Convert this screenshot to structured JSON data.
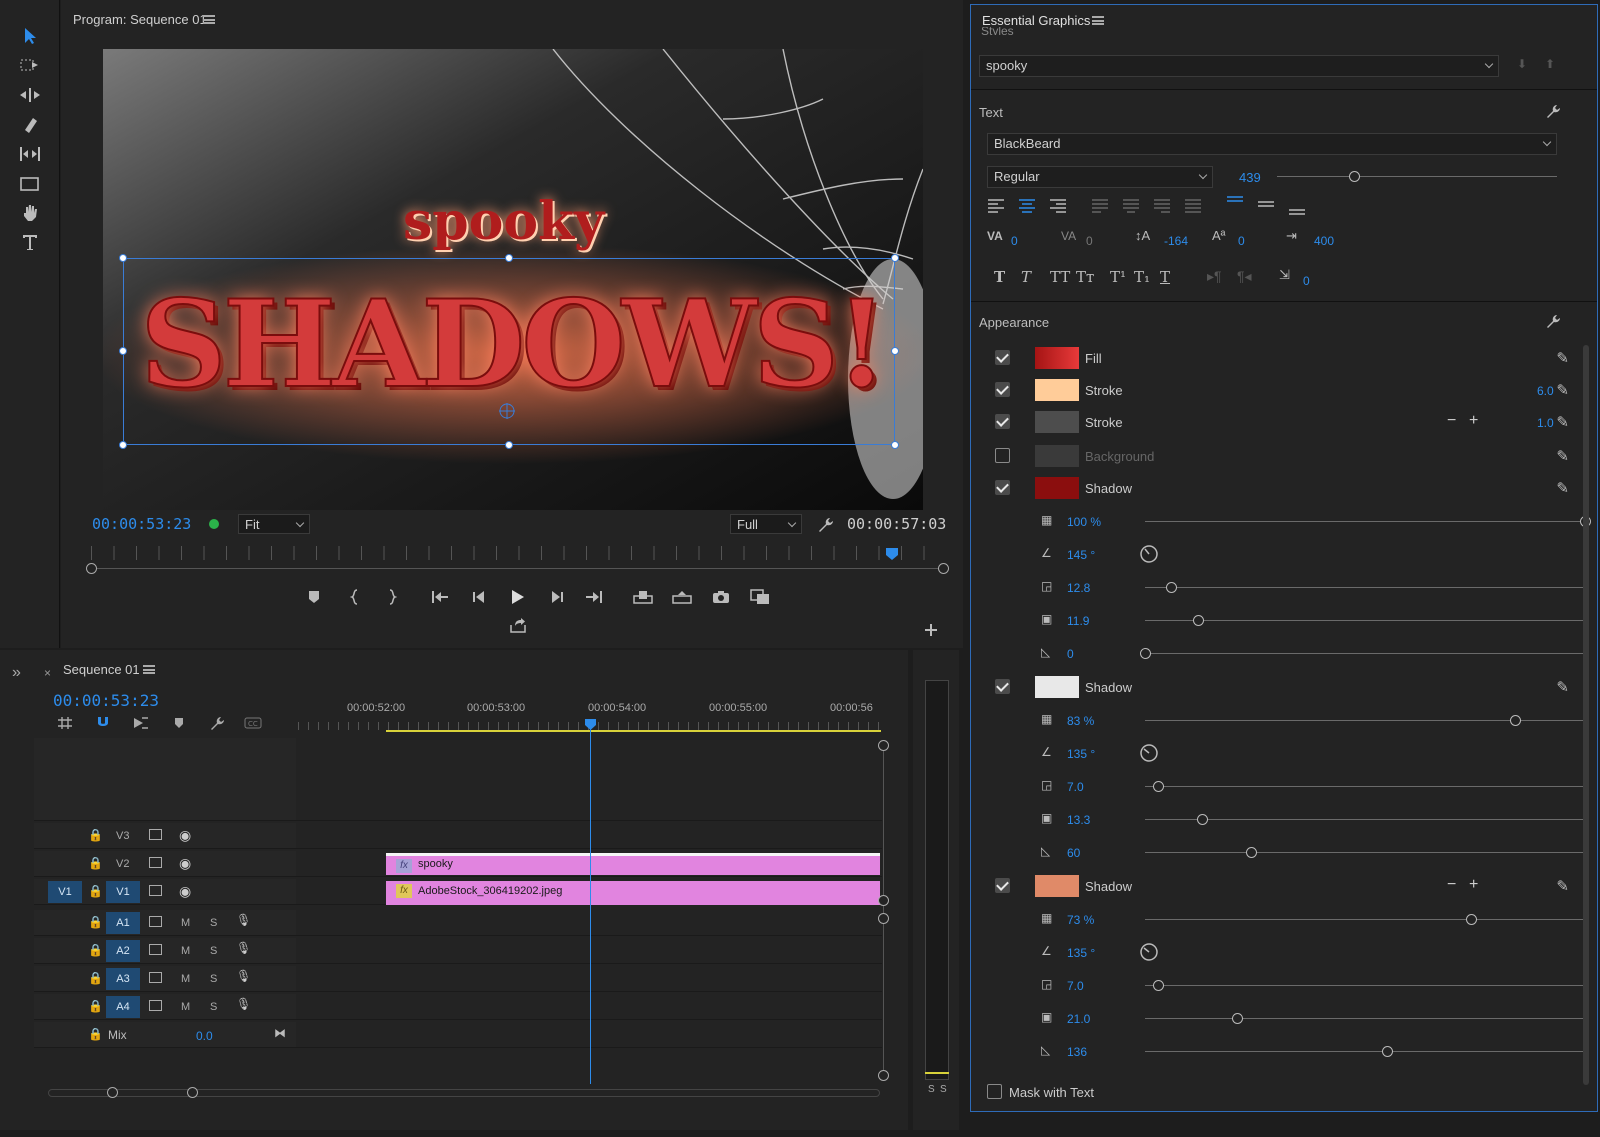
{
  "program": {
    "title": "Program: Sequence 01",
    "timecode_current": "00:00:53:23",
    "timecode_duration": "00:00:57:03",
    "zoom": "Fit",
    "quality": "Full",
    "video_text_small": "spooky",
    "video_text_big": "SHADOWS!"
  },
  "timeline": {
    "title": "Sequence 01",
    "timecode": "00:00:53:23",
    "ruler": [
      "00:00:52:00",
      "00:00:53:00",
      "00:00:54:00",
      "00:00:55:00",
      "00:00:56"
    ],
    "video_tracks": [
      "V3",
      "V2",
      "V1"
    ],
    "source_patch": "V1",
    "audio_tracks": [
      "A1",
      "A2",
      "A3",
      "A4"
    ],
    "mute": "M",
    "solo": "S",
    "mix_label": "Mix",
    "mix_value": "0.0",
    "clips": {
      "v2": "spooky",
      "v1": "AdobeStock_306419202.jpeg"
    },
    "fx": "fx",
    "meter_labels": [
      "S",
      "S"
    ]
  },
  "eg": {
    "title": "Essential Graphics",
    "styles_label": "Styles",
    "style_value": "spooky",
    "text_section": "Text",
    "font": "BlackBeard",
    "font_style": "Regular",
    "font_size": "439",
    "kerning": "0",
    "tracking": "0",
    "leading": "-164",
    "baseline": "0",
    "tsume": "400",
    "tab_width": "0",
    "appearance_section": "Appearance",
    "fill_label": "Fill",
    "stroke1_label": "Stroke",
    "stroke1_value": "6.0",
    "stroke2_label": "Stroke",
    "stroke2_value": "1.0",
    "background_label": "Background",
    "shadows": [
      {
        "label": "Shadow",
        "opacity": "100 %",
        "angle": "145 °",
        "distance": "12.8",
        "size": "11.9",
        "blur": "0",
        "opacity_level": 1.0,
        "distance_level": 0.06,
        "size_level": 0.12,
        "blur_level": 0.0
      },
      {
        "label": "Shadow",
        "opacity": "83 %",
        "angle": "135 °",
        "distance": "7.0",
        "size": "13.3",
        "blur": "60",
        "opacity_level": 0.84,
        "distance_level": 0.03,
        "size_level": 0.13,
        "blur_level": 0.24
      },
      {
        "label": "Shadow",
        "opacity": "73 %",
        "angle": "135 °",
        "distance": "7.0",
        "size": "21.0",
        "blur": "136",
        "opacity_level": 0.74,
        "distance_level": 0.03,
        "size_level": 0.21,
        "blur_level": 0.55
      }
    ],
    "mask_label": "Mask with Text",
    "colors": {
      "fill": "#c81a1a",
      "stroke1": "#ffcc99",
      "stroke2": "#4d4d4d",
      "background": "#3a3a3a",
      "shadow1": "#8b0e0e",
      "shadow2": "#e8e8e8",
      "shadow3": "#e08a68"
    }
  }
}
